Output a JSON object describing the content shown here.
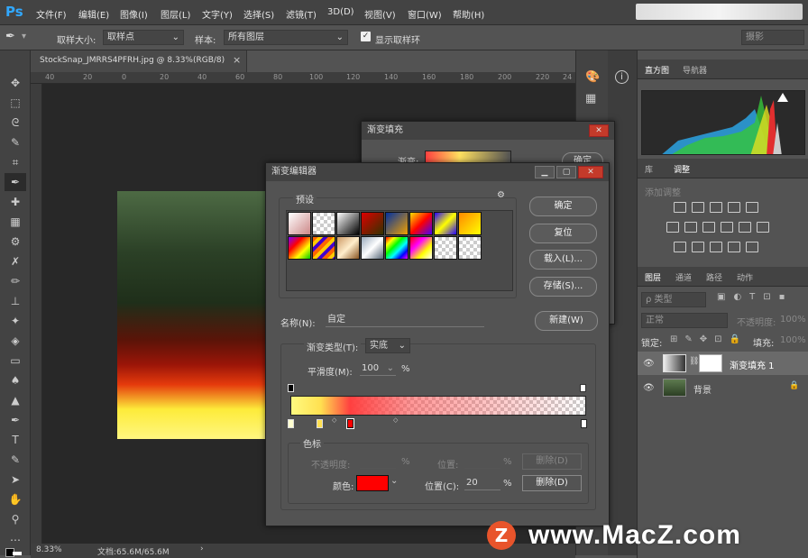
{
  "menubar": {
    "logo": "Ps",
    "items": [
      "文件(F)",
      "编辑(E)",
      "图像(I)",
      "图层(L)",
      "文字(Y)",
      "选择(S)",
      "滤镜(T)",
      "3D(D)",
      "视图(V)",
      "窗口(W)",
      "帮助(H)"
    ]
  },
  "options": {
    "sample_size_label": "取样大小:",
    "sample_size_value": "取样点",
    "sample_label": "样本:",
    "sample_value": "所有图层",
    "show_ring_label": "显示取样环",
    "workspace": "摄影"
  },
  "document": {
    "tab_title": "StockSnap_JMRRS4PFRH.jpg @ 8.33%(RGB/8)",
    "close": "×",
    "ruler": [
      "40",
      "20",
      "0",
      "20",
      "40",
      "60",
      "80",
      "100",
      "120",
      "140",
      "160",
      "180",
      "200",
      "220",
      "24"
    ]
  },
  "status": {
    "zoom": "8.33%",
    "doc": "文档:65.6M/65.6M",
    "arrow": "›"
  },
  "panels": {
    "histogram_tabs": [
      "直方图",
      "导航器"
    ],
    "adjust_tabs": [
      "库",
      "调整"
    ],
    "adjust_title": "添加调整",
    "layer_tabs": [
      "图层",
      "通道",
      "路径",
      "动作"
    ],
    "layer_filter": "ρ 类型",
    "blend_mode": "正常",
    "opacity_label": "不透明度:",
    "opacity_value": "100%",
    "lock_label": "锁定:",
    "fill_label": "填充:",
    "fill_value": "100%",
    "layers": [
      {
        "name": "渐变填充 1"
      },
      {
        "name": "背景"
      }
    ]
  },
  "gradient_fill": {
    "title": "渐变填充",
    "gradient_label": "渐变:",
    "ok": "确定"
  },
  "gradient_editor": {
    "title": "渐变编辑器",
    "presets_label": "预设",
    "buttons": {
      "ok": "确定",
      "reset": "复位",
      "load": "载入(L)...",
      "save": "存储(S)...",
      "new": "新建(W)"
    },
    "name_label": "名称(N):",
    "name_value": "自定",
    "type_label": "渐变类型(T):",
    "type_value": "实底",
    "smooth_label": "平滑度(M):",
    "smooth_value": "100",
    "smooth_unit": "%",
    "stops_label": "色标",
    "opacity_label": "不透明度:",
    "opacity_unit": "%",
    "loc_label": "位置:",
    "loc_unit": "%",
    "delete_label": "删除(D)",
    "color_label": "颜色:",
    "color_loc_label": "位置(C):",
    "color_loc_value": "20",
    "color_loc_unit": "%",
    "color_value": "#ff0000"
  },
  "watermark": {
    "text": "www.MacZ.com",
    "logo": "Z"
  }
}
